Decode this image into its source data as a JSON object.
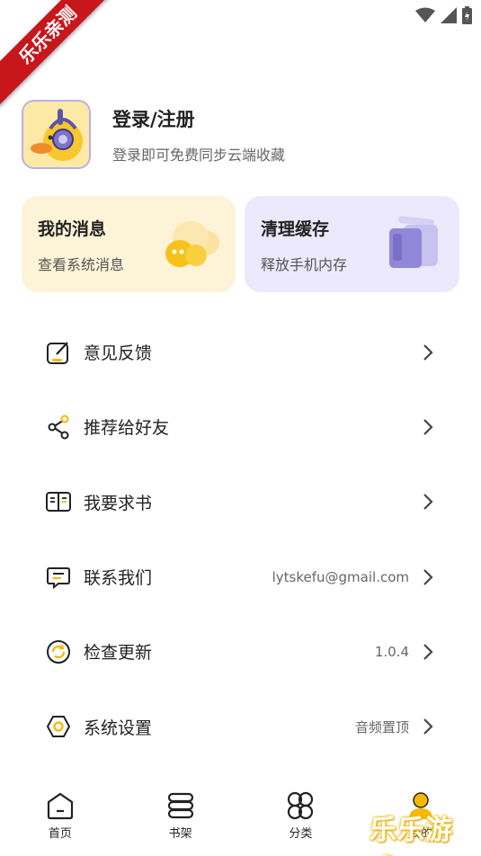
{
  "watermark": {
    "ribbon_text": "乐乐亲测",
    "logo_text": "乐乐游戏"
  },
  "profile": {
    "title": "登录/注册",
    "subtitle": "登录即可免费同步云端收藏"
  },
  "cards": [
    {
      "title": "我的消息",
      "subtitle": "查看系统消息"
    },
    {
      "title": "清理缓存",
      "subtitle": "释放手机内存"
    }
  ],
  "menu": [
    {
      "label": "意见反馈",
      "value": "",
      "icon": "feedback-edit-icon"
    },
    {
      "label": "推荐给好友",
      "value": "",
      "icon": "share-icon"
    },
    {
      "label": "我要求书",
      "value": "",
      "icon": "open-book-icon"
    },
    {
      "label": "联系我们",
      "value": "lytskefu@gmail.com",
      "icon": "message-icon"
    },
    {
      "label": "检查更新",
      "value": "1.0.4",
      "icon": "refresh-icon"
    },
    {
      "label": "系统设置",
      "value": "音频置顶",
      "icon": "settings-hexagon-icon"
    }
  ],
  "tabs": [
    {
      "label": "首页",
      "icon": "home-icon"
    },
    {
      "label": "书架",
      "icon": "bookshelf-icon"
    },
    {
      "label": "分类",
      "icon": "category-icon"
    },
    {
      "label": "我的",
      "icon": "profile-icon",
      "active": true
    }
  ],
  "colors": {
    "accent_yellow": "#f6b800",
    "accent_purple": "#8f86d6",
    "msg_card_bg": "#fdf3d6",
    "cache_card_bg": "#ebe9fb"
  }
}
